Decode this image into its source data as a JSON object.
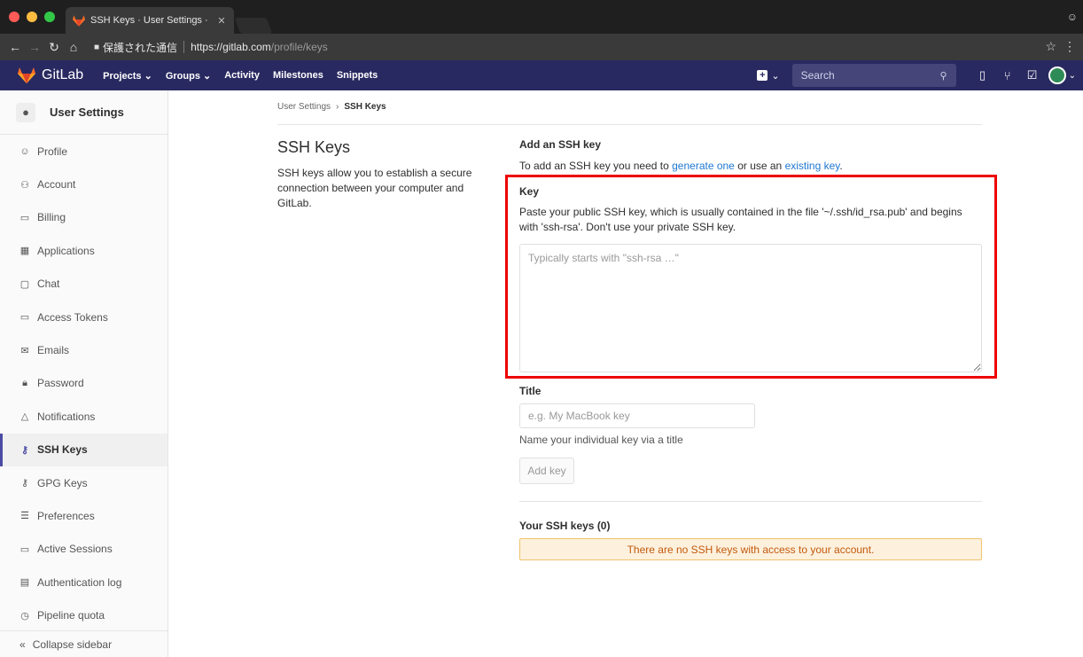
{
  "browser": {
    "tab_title": "SSH Keys · User Settings · Gitl",
    "secure_label": "保護された通信",
    "url_host": "https://gitlab.com",
    "url_path": "/profile/keys"
  },
  "navbar": {
    "brand": "GitLab",
    "links": [
      "Projects ⌄",
      "Groups ⌄",
      "Activity",
      "Milestones",
      "Snippets"
    ],
    "search_placeholder": "Search",
    "accent": "#292961"
  },
  "sidebar": {
    "title": "User Settings",
    "items": [
      {
        "label": "Profile",
        "icon": "profile-icon"
      },
      {
        "label": "Account",
        "icon": "account-icon"
      },
      {
        "label": "Billing",
        "icon": "billing-icon"
      },
      {
        "label": "Applications",
        "icon": "applications-icon"
      },
      {
        "label": "Chat",
        "icon": "chat-icon"
      },
      {
        "label": "Access Tokens",
        "icon": "token-icon"
      },
      {
        "label": "Emails",
        "icon": "email-icon"
      },
      {
        "label": "Password",
        "icon": "lock-icon"
      },
      {
        "label": "Notifications",
        "icon": "bell-icon"
      },
      {
        "label": "SSH Keys",
        "icon": "key-icon",
        "active": true
      },
      {
        "label": "GPG Keys",
        "icon": "key-icon"
      },
      {
        "label": "Preferences",
        "icon": "sliders-icon"
      },
      {
        "label": "Active Sessions",
        "icon": "monitor-icon"
      },
      {
        "label": "Authentication log",
        "icon": "log-icon"
      },
      {
        "label": "Pipeline quota",
        "icon": "quota-icon"
      }
    ],
    "collapse_label": "Collapse sidebar"
  },
  "breadcrumb": {
    "parent": "User Settings",
    "separator": "›",
    "current": "SSH Keys"
  },
  "intro": {
    "heading": "SSH Keys",
    "description": "SSH keys allow you to establish a secure connection between your computer and GitLab."
  },
  "form": {
    "add_title": "Add an SSH key",
    "add_intro_prefix": "To add an SSH key you need to ",
    "generate_link": "generate one",
    "add_intro_middle": " or use an ",
    "existing_link": "existing key",
    "add_intro_suffix": ".",
    "key_label": "Key",
    "key_help": "Paste your public SSH key, which is usually contained in the file '~/.ssh/id_rsa.pub' and begins with 'ssh-rsa'. Don't use your private SSH key.",
    "key_placeholder": "Typically starts with \"ssh-rsa …\"",
    "key_value": "",
    "title_label": "Title",
    "title_placeholder": "e.g. My MacBook key",
    "title_value": "",
    "title_help": "Name your individual key via a title",
    "submit_label": "Add key"
  },
  "keys_list": {
    "heading": "Your SSH keys (0)",
    "empty_message": "There are no SSH keys with access to your account."
  },
  "highlight_color": "#ee0000"
}
